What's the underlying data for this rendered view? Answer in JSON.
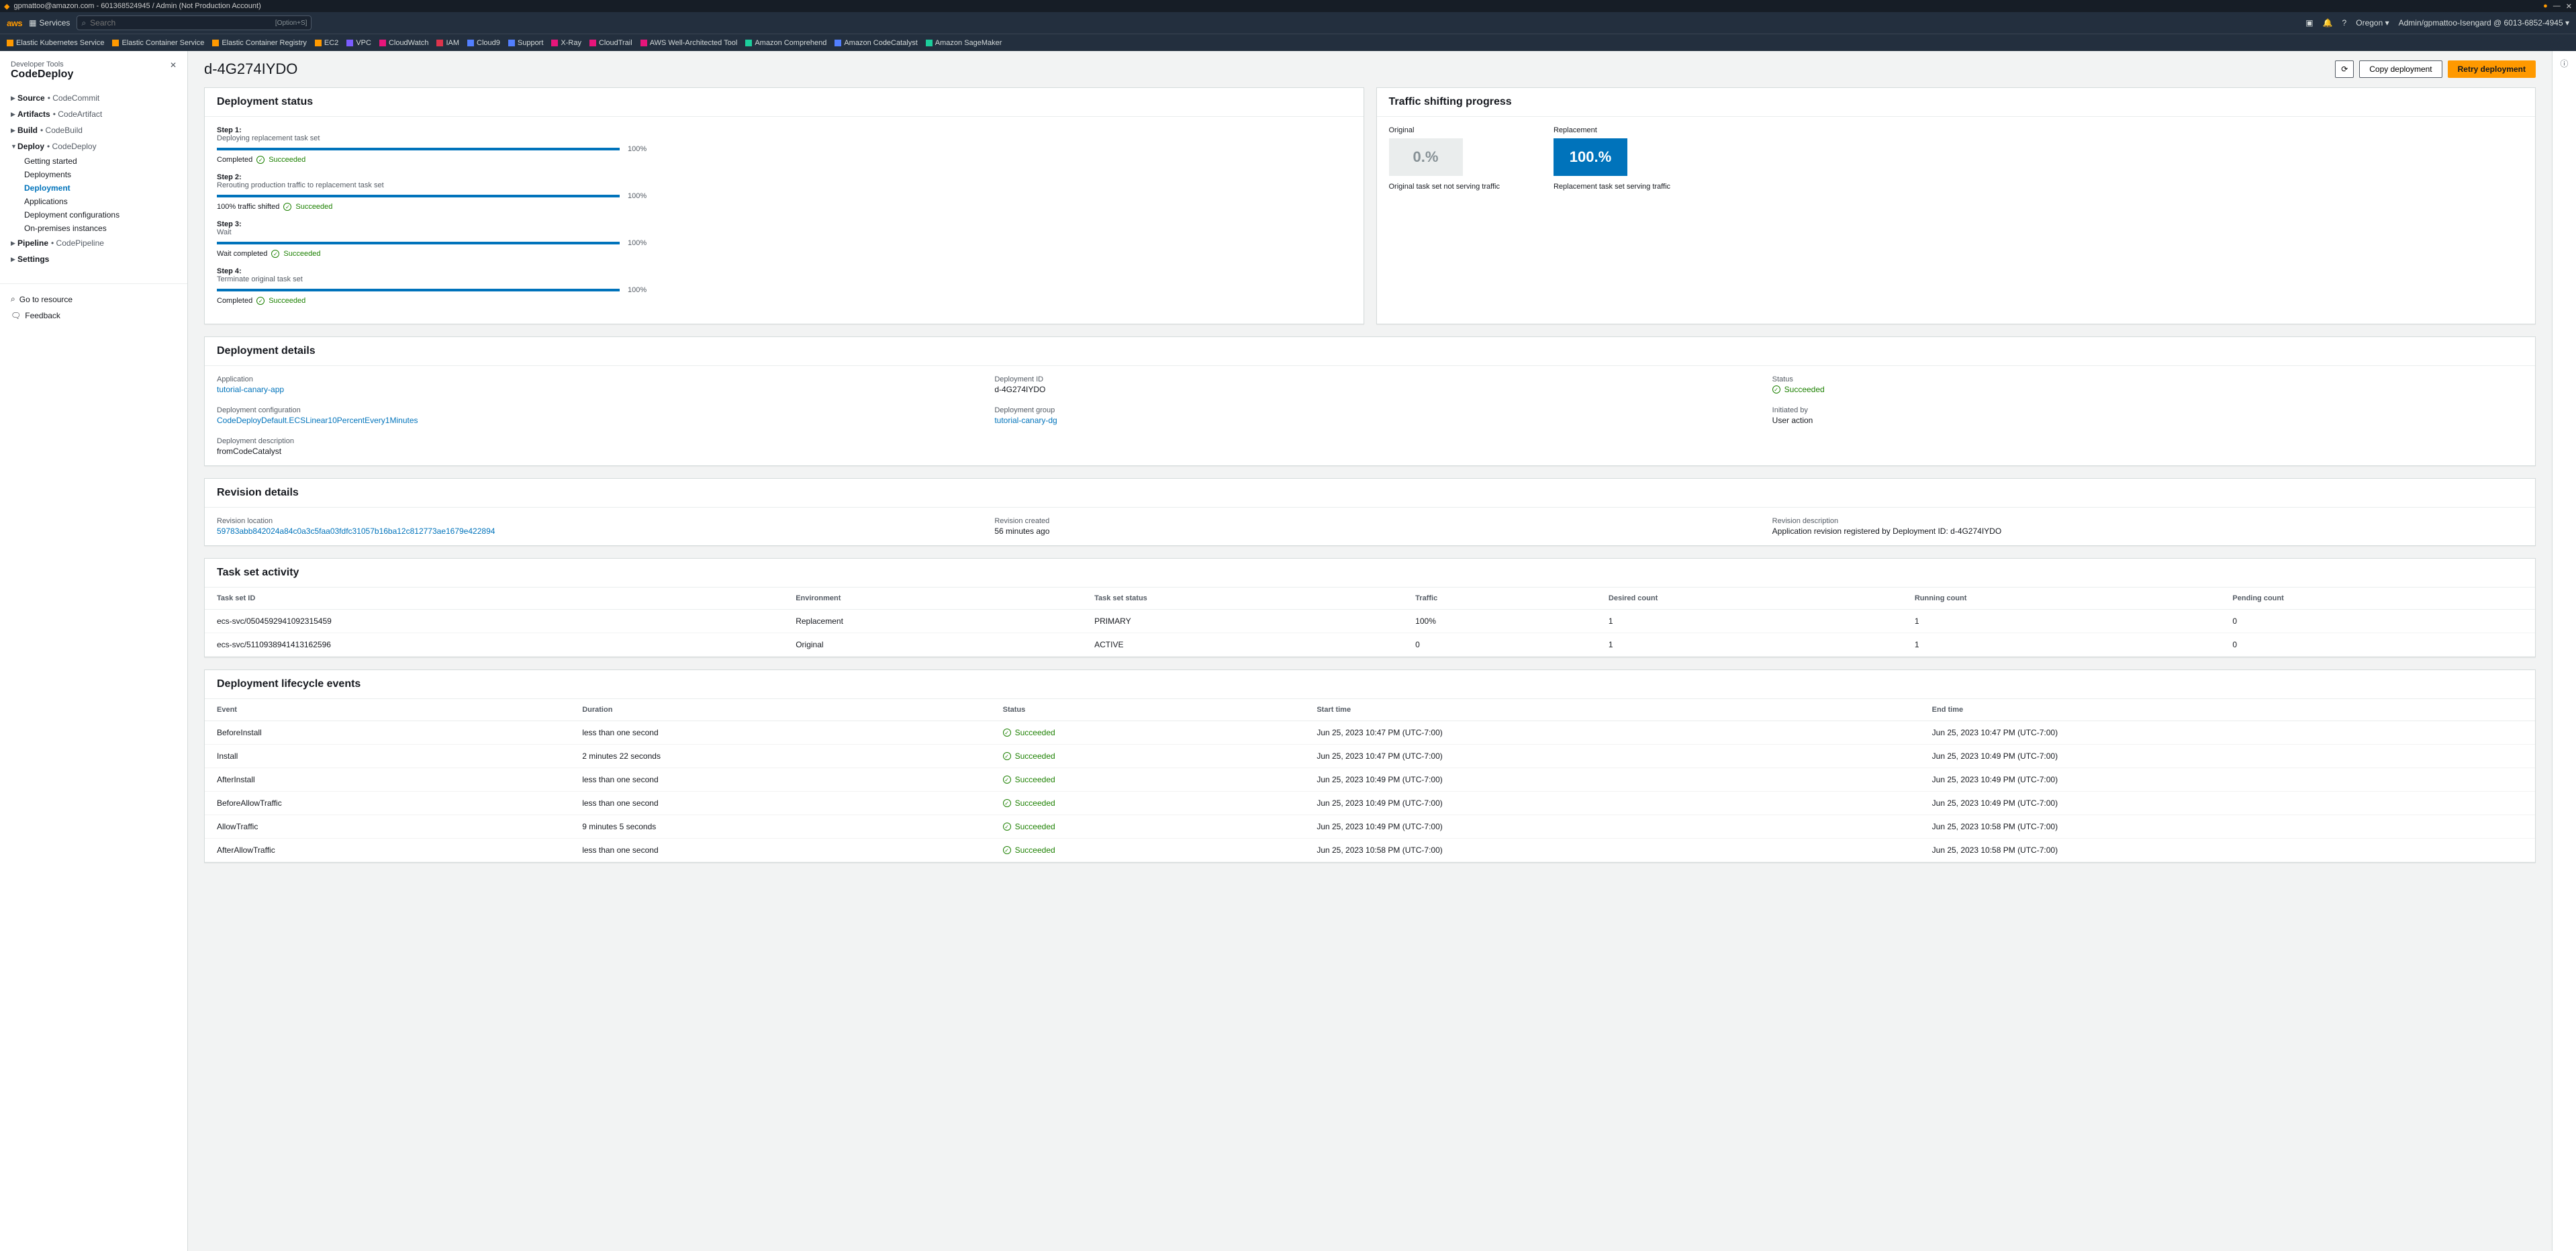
{
  "titlebar": {
    "account": "gpmattoo@amazon.com - 601368524945 / Admin (Not Production Account)"
  },
  "navbar": {
    "services": "Services",
    "search_placeholder": "Search",
    "shortcut": "[Option+S]",
    "region": "Oregon",
    "user": "Admin/gpmattoo-Isengard @ 6013-6852-4945"
  },
  "favorites": [
    {
      "label": "Elastic Kubernetes Service",
      "color": "#ff9900"
    },
    {
      "label": "Elastic Container Service",
      "color": "#ff9900"
    },
    {
      "label": "Elastic Container Registry",
      "color": "#ff9900"
    },
    {
      "label": "EC2",
      "color": "#ff9900"
    },
    {
      "label": "VPC",
      "color": "#7a5cff"
    },
    {
      "label": "CloudWatch",
      "color": "#e7157b"
    },
    {
      "label": "IAM",
      "color": "#dd344c"
    },
    {
      "label": "Cloud9",
      "color": "#527fff"
    },
    {
      "label": "Support",
      "color": "#527fff"
    },
    {
      "label": "X-Ray",
      "color": "#e7157b"
    },
    {
      "label": "CloudTrail",
      "color": "#e7157b"
    },
    {
      "label": "AWS Well-Architected Tool",
      "color": "#e7157b"
    },
    {
      "label": "Amazon Comprehend",
      "color": "#1cce9c"
    },
    {
      "label": "Amazon CodeCatalyst",
      "color": "#527fff"
    },
    {
      "label": "Amazon SageMaker",
      "color": "#1cce9c"
    }
  ],
  "sidebar": {
    "sup": "Developer Tools",
    "title": "CodeDeploy",
    "items": [
      {
        "label": "Source",
        "svc": "CodeCommit"
      },
      {
        "label": "Artifacts",
        "svc": "CodeArtifact"
      },
      {
        "label": "Build",
        "svc": "CodeBuild"
      },
      {
        "label": "Deploy",
        "svc": "CodeDeploy",
        "expanded": true,
        "children": [
          "Getting started",
          "Deployments",
          "Deployment",
          "Applications",
          "Deployment configurations",
          "On-premises instances"
        ],
        "active_child": 2
      },
      {
        "label": "Pipeline",
        "svc": "CodePipeline"
      },
      {
        "label": "Settings"
      }
    ],
    "resource": "Go to resource",
    "feedback": "Feedback"
  },
  "page": {
    "title": "d-4G274IYDO",
    "copy_btn": "Copy deployment",
    "retry_btn": "Retry deployment"
  },
  "deploy_status": {
    "heading": "Deployment status",
    "steps": [
      {
        "title": "Step 1:",
        "desc": "Deploying replacement task set",
        "pct": "100%",
        "status_pre": "Completed",
        "status": "Succeeded"
      },
      {
        "title": "Step 2:",
        "desc": "Rerouting production traffic to replacement task set",
        "pct": "100%",
        "status_pre": "100% traffic shifted",
        "status": "Succeeded"
      },
      {
        "title": "Step 3:",
        "desc": "Wait",
        "pct": "100%",
        "status_pre": "Wait completed",
        "status": "Succeeded"
      },
      {
        "title": "Step 4:",
        "desc": "Terminate original task set",
        "pct": "100%",
        "status_pre": "Completed",
        "status": "Succeeded"
      }
    ]
  },
  "traffic": {
    "heading": "Traffic shifting progress",
    "original": {
      "label": "Original",
      "pct": "0.%",
      "cap": "Original task set not serving traffic"
    },
    "replacement": {
      "label": "Replacement",
      "pct": "100.%",
      "cap": "Replacement task set serving traffic"
    }
  },
  "details": {
    "heading": "Deployment details",
    "rows": [
      [
        {
          "k": "Application",
          "v": "tutorial-canary-app",
          "link": true
        },
        {
          "k": "Deployment ID",
          "v": "d-4G274IYDO"
        },
        {
          "k": "Status",
          "v": "Succeeded",
          "status": true
        }
      ],
      [
        {
          "k": "Deployment configuration",
          "v": "CodeDeployDefault.ECSLinear10PercentEvery1Minutes",
          "link": true
        },
        {
          "k": "Deployment group",
          "v": "tutorial-canary-dg",
          "link": true
        },
        {
          "k": "Initiated by",
          "v": "User action"
        }
      ],
      [
        {
          "k": "Deployment description",
          "v": "fromCodeCatalyst"
        }
      ]
    ]
  },
  "revision": {
    "heading": "Revision details",
    "rows": [
      {
        "k": "Revision location",
        "v": "59783abb842024a84c0a3c5faa03fdfc31057b16ba12c812773ae1679e422894",
        "link": true
      },
      {
        "k": "Revision created",
        "v": "56 minutes ago"
      },
      {
        "k": "Revision description",
        "v": "Application revision registered by Deployment ID: d-4G274IYDO"
      }
    ]
  },
  "taskset": {
    "heading": "Task set activity",
    "cols": [
      "Task set ID",
      "Environment",
      "Task set status",
      "Traffic",
      "Desired count",
      "Running count",
      "Pending count"
    ],
    "rows": [
      [
        "ecs-svc/0504592941092315459",
        "Replacement",
        "PRIMARY",
        "100%",
        "1",
        "1",
        "0"
      ],
      [
        "ecs-svc/5110938941413162596",
        "Original",
        "ACTIVE",
        "0",
        "1",
        "1",
        "0"
      ]
    ]
  },
  "lifecycle": {
    "heading": "Deployment lifecycle events",
    "cols": [
      "Event",
      "Duration",
      "Status",
      "Start time",
      "End time"
    ],
    "rows": [
      [
        "BeforeInstall",
        "less than one second",
        "Succeeded",
        "Jun 25, 2023 10:47 PM (UTC-7:00)",
        "Jun 25, 2023 10:47 PM (UTC-7:00)"
      ],
      [
        "Install",
        "2 minutes 22 seconds",
        "Succeeded",
        "Jun 25, 2023 10:47 PM (UTC-7:00)",
        "Jun 25, 2023 10:49 PM (UTC-7:00)"
      ],
      [
        "AfterInstall",
        "less than one second",
        "Succeeded",
        "Jun 25, 2023 10:49 PM (UTC-7:00)",
        "Jun 25, 2023 10:49 PM (UTC-7:00)"
      ],
      [
        "BeforeAllowTraffic",
        "less than one second",
        "Succeeded",
        "Jun 25, 2023 10:49 PM (UTC-7:00)",
        "Jun 25, 2023 10:49 PM (UTC-7:00)"
      ],
      [
        "AllowTraffic",
        "9 minutes 5 seconds",
        "Succeeded",
        "Jun 25, 2023 10:49 PM (UTC-7:00)",
        "Jun 25, 2023 10:58 PM (UTC-7:00)"
      ],
      [
        "AfterAllowTraffic",
        "less than one second",
        "Succeeded",
        "Jun 25, 2023 10:58 PM (UTC-7:00)",
        "Jun 25, 2023 10:58 PM (UTC-7:00)"
      ]
    ]
  }
}
